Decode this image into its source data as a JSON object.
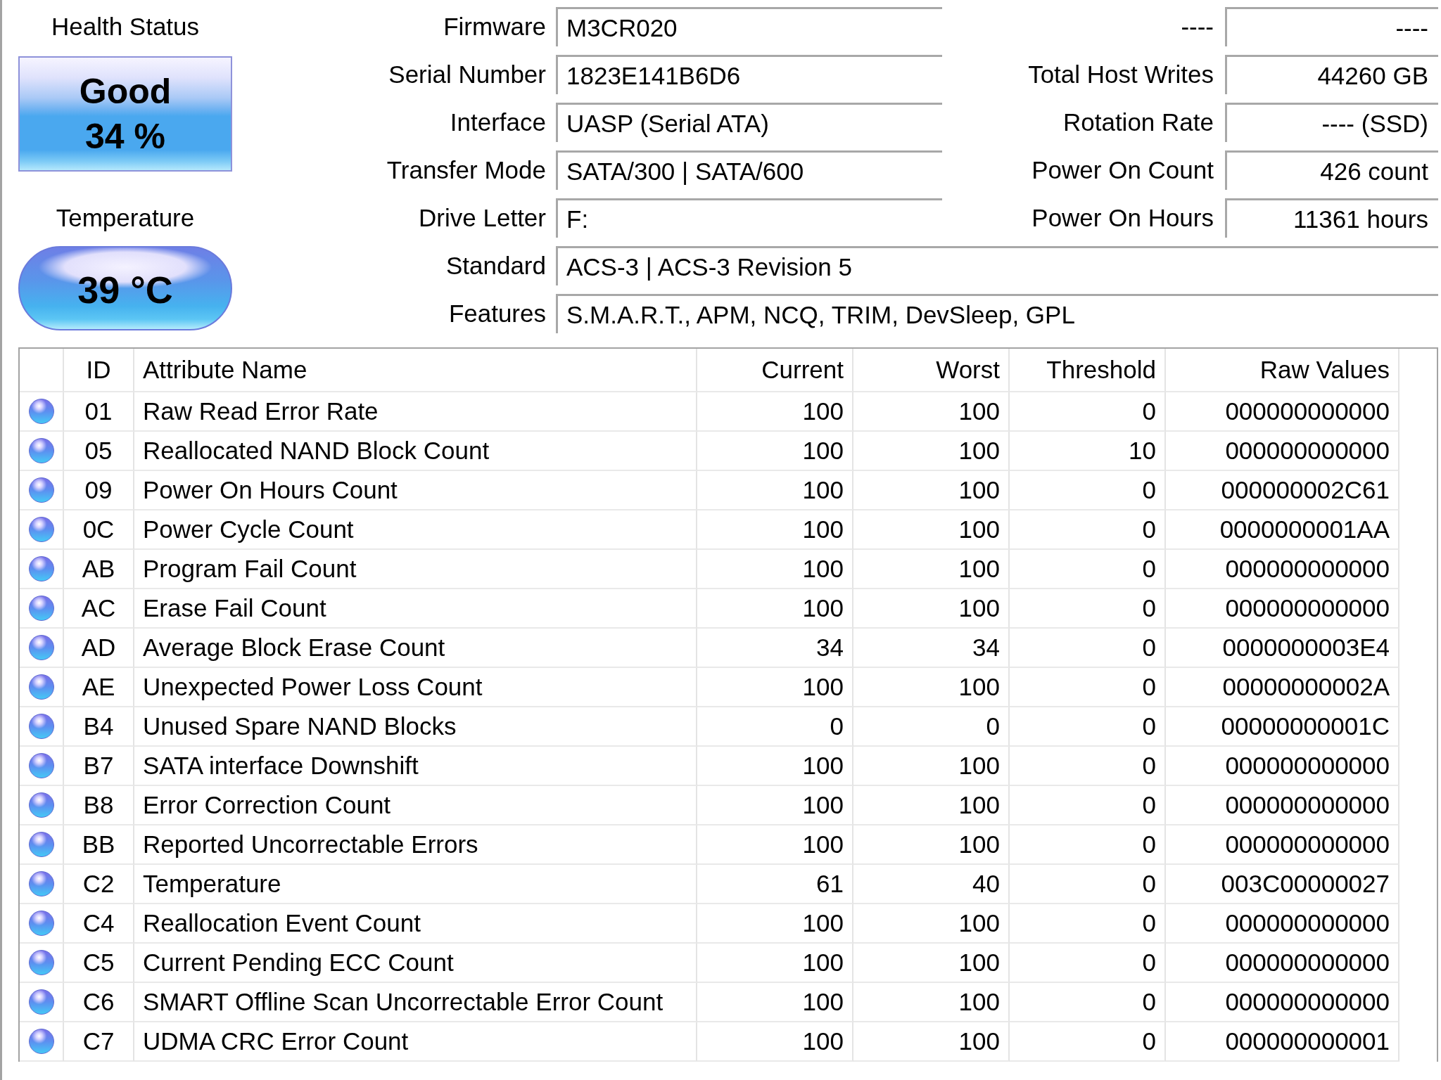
{
  "health": {
    "label": "Health Status",
    "status": "Good",
    "percent": "34 %",
    "kind": "good"
  },
  "temperature": {
    "label": "Temperature",
    "value": "39 °C",
    "kind": "good"
  },
  "drive_info": [
    {
      "label": "Firmware",
      "value": "M3CR020",
      "side": {
        "label": "----",
        "value": "----"
      }
    },
    {
      "label": "Serial Number",
      "value": "1823E141B6D6",
      "side": {
        "label": "Total Host Writes",
        "value": "44260 GB"
      }
    },
    {
      "label": "Interface",
      "value": "UASP (Serial ATA)",
      "side": {
        "label": "Rotation Rate",
        "value": "---- (SSD)"
      }
    },
    {
      "label": "Transfer Mode",
      "value": "SATA/300 | SATA/600",
      "side": {
        "label": "Power On Count",
        "value": "426 count"
      }
    },
    {
      "label": "Drive Letter",
      "value": "F:",
      "side": {
        "label": "Power On Hours",
        "value": "11361 hours"
      }
    },
    {
      "label": "Standard",
      "value": "ACS-3 | ACS-3 Revision 5"
    },
    {
      "label": "Features",
      "value": "S.M.A.R.T., APM, NCQ, TRIM, DevSleep, GPL"
    }
  ],
  "smart_table": {
    "columns": [
      "ID",
      "Attribute Name",
      "Current",
      "Worst",
      "Threshold",
      "Raw Values"
    ],
    "rows": [
      {
        "kind": "good",
        "id": "01",
        "name": "Raw Read Error Rate",
        "current": "100",
        "worst": "100",
        "threshold": "0",
        "raw": "000000000000"
      },
      {
        "kind": "good",
        "id": "05",
        "name": "Reallocated NAND Block Count",
        "current": "100",
        "worst": "100",
        "threshold": "10",
        "raw": "000000000000"
      },
      {
        "kind": "good",
        "id": "09",
        "name": "Power On Hours Count",
        "current": "100",
        "worst": "100",
        "threshold": "0",
        "raw": "000000002C61"
      },
      {
        "kind": "good",
        "id": "0C",
        "name": "Power Cycle Count",
        "current": "100",
        "worst": "100",
        "threshold": "0",
        "raw": "0000000001AA"
      },
      {
        "kind": "good",
        "id": "AB",
        "name": "Program Fail Count",
        "current": "100",
        "worst": "100",
        "threshold": "0",
        "raw": "000000000000"
      },
      {
        "kind": "good",
        "id": "AC",
        "name": "Erase Fail Count",
        "current": "100",
        "worst": "100",
        "threshold": "0",
        "raw": "000000000000"
      },
      {
        "kind": "good",
        "id": "AD",
        "name": "Average Block Erase Count",
        "current": "34",
        "worst": "34",
        "threshold": "0",
        "raw": "0000000003E4"
      },
      {
        "kind": "good",
        "id": "AE",
        "name": "Unexpected Power Loss Count",
        "current": "100",
        "worst": "100",
        "threshold": "0",
        "raw": "00000000002A"
      },
      {
        "kind": "good",
        "id": "B4",
        "name": "Unused Spare NAND Blocks",
        "current": "0",
        "worst": "0",
        "threshold": "0",
        "raw": "00000000001C"
      },
      {
        "kind": "good",
        "id": "B7",
        "name": "SATA interface Downshift",
        "current": "100",
        "worst": "100",
        "threshold": "0",
        "raw": "000000000000"
      },
      {
        "kind": "good",
        "id": "B8",
        "name": "Error Correction Count",
        "current": "100",
        "worst": "100",
        "threshold": "0",
        "raw": "000000000000"
      },
      {
        "kind": "good",
        "id": "BB",
        "name": "Reported Uncorrectable Errors",
        "current": "100",
        "worst": "100",
        "threshold": "0",
        "raw": "000000000000"
      },
      {
        "kind": "good",
        "id": "C2",
        "name": "Temperature",
        "current": "61",
        "worst": "40",
        "threshold": "0",
        "raw": "003C00000027"
      },
      {
        "kind": "good",
        "id": "C4",
        "name": "Reallocation Event Count",
        "current": "100",
        "worst": "100",
        "threshold": "0",
        "raw": "000000000000"
      },
      {
        "kind": "good",
        "id": "C5",
        "name": "Current Pending ECC Count",
        "current": "100",
        "worst": "100",
        "threshold": "0",
        "raw": "000000000000"
      },
      {
        "kind": "good",
        "id": "C6",
        "name": "SMART Offline Scan Uncorrectable Error Count",
        "current": "100",
        "worst": "100",
        "threshold": "0",
        "raw": "000000000000"
      },
      {
        "kind": "good",
        "id": "C7",
        "name": "UDMA CRC Error Count",
        "current": "100",
        "worst": "100",
        "threshold": "0",
        "raw": "000000000001"
      }
    ]
  }
}
